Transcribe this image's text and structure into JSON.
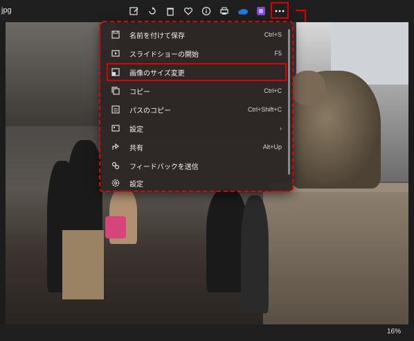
{
  "titlebar": {
    "file_name": "jpg",
    "icons": [
      "edit-icon",
      "rotate-icon",
      "delete-icon",
      "favorite-icon",
      "info-icon",
      "print-icon",
      "onedrive-icon",
      "clipchamp-icon",
      "more-icon"
    ]
  },
  "menu": {
    "items": [
      {
        "label": "名前を付けて保存",
        "shortcut": "Ctrl+S",
        "icon": "save-icon"
      },
      {
        "label": "スライドショーの開始",
        "shortcut": "F5",
        "icon": "slideshow-icon"
      },
      {
        "label": "画像のサイズ変更",
        "shortcut": "",
        "icon": "resize-icon",
        "highlighted": true
      },
      {
        "label": "コピー",
        "shortcut": "Ctrl+C",
        "icon": "copy-icon"
      },
      {
        "label": "パスのコピー",
        "shortcut": "Ctrl+Shift+C",
        "icon": "copy-path-icon"
      },
      {
        "label": "設定",
        "shortcut": "›",
        "icon": "set-as-icon"
      },
      {
        "label": "共有",
        "shortcut": "Alt+Up",
        "icon": "share-icon"
      },
      {
        "label": "フィードバックを送信",
        "shortcut": "",
        "icon": "feedback-icon"
      },
      {
        "label": "設定",
        "shortcut": "",
        "icon": "settings-icon"
      }
    ]
  },
  "status": {
    "zoom": "16%"
  },
  "colors": {
    "annotation": "#e00000",
    "menu_bg": "#2c2624"
  }
}
